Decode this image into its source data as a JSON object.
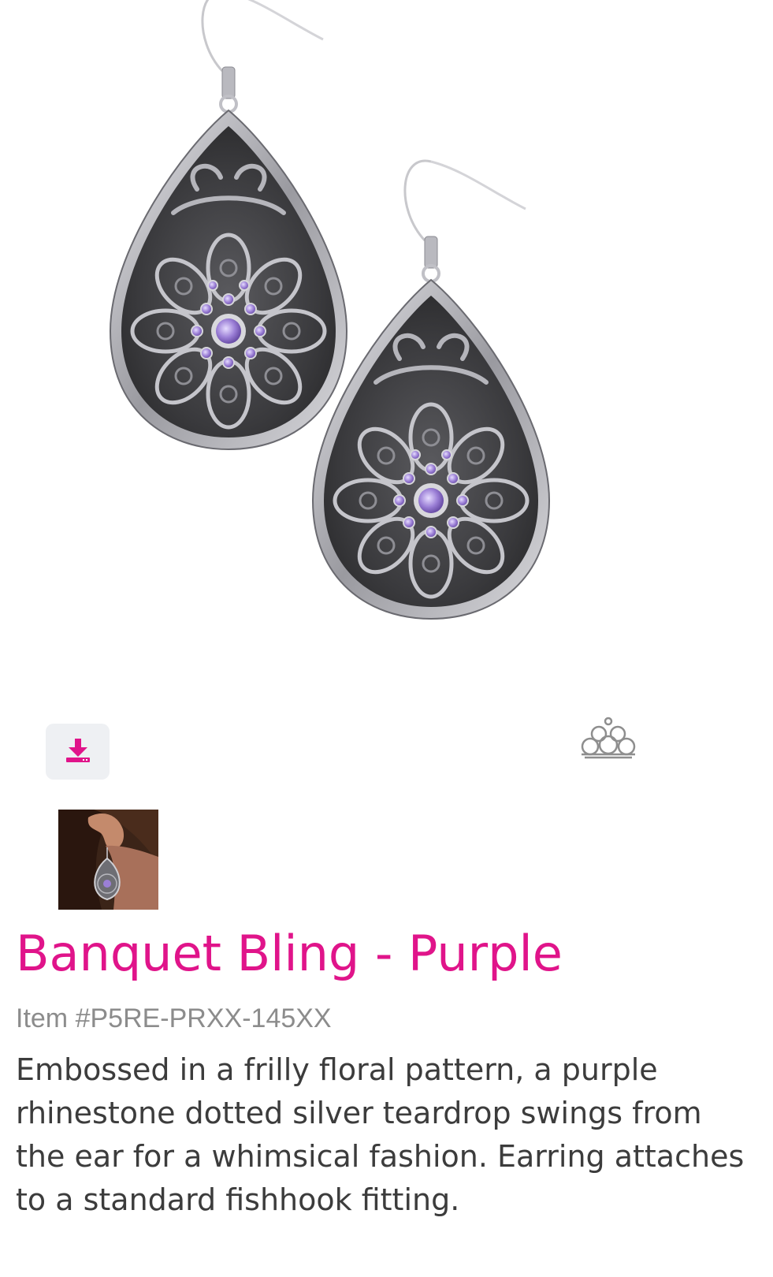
{
  "product": {
    "name": "Banquet Bling - Purple",
    "item_number": "Item #P5RE-PRXX-145XX",
    "description": "Embossed in a frilly floral pattern, a purple rhinestone dotted silver teardrop swings from the ear for a whimsical fashion. Earring attaches to a standard fishhook fitting."
  },
  "icons": {
    "download": "download-icon",
    "logo": "paparazzi-logo-icon"
  },
  "colors": {
    "accent": "#e0148a",
    "description_text": "#3c3c3c",
    "item_text": "#8c8c8c",
    "button_bg": "#eef0f3",
    "metal_dark": "#3a3a3c",
    "metal_light": "#c8c8cc",
    "stone": "#9b7fd6"
  }
}
